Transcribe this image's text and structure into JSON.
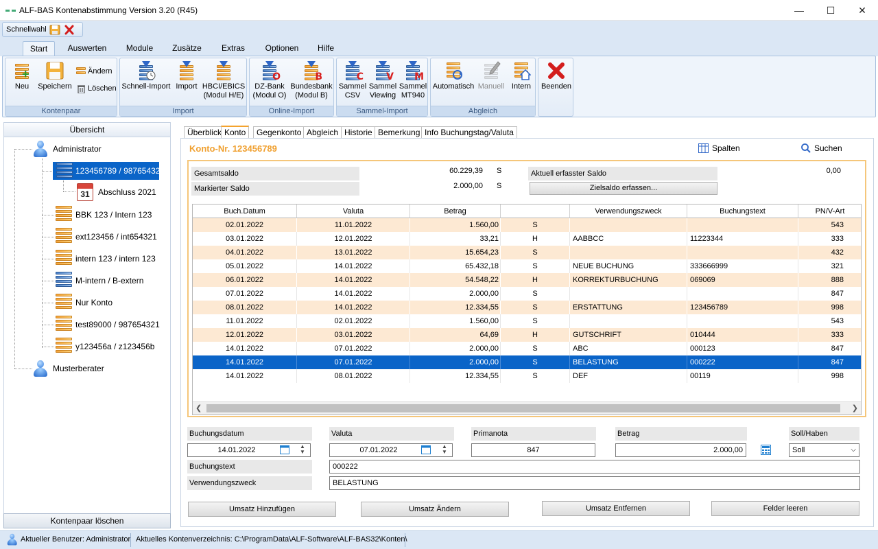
{
  "window": {
    "title": "ALF-BAS Kontenabstimmung Version 3.20 (R45)",
    "minimize": "—",
    "maximize": "☐",
    "close": "✕"
  },
  "quick_access": {
    "label": "Schnellwahl"
  },
  "ribbon": {
    "tabs": [
      "Start",
      "Auswerten",
      "Module",
      "Zusätze",
      "Extras",
      "Optionen",
      "Hilfe"
    ],
    "active_tab": "Start",
    "groups": {
      "kontenpaar": {
        "label": "Kontenpaar",
        "neu": "Neu",
        "speichern": "Speichern",
        "aendern": "Ändern",
        "loeschen": "Löschen"
      },
      "import": {
        "label": "Import",
        "schnell": "Schnell-Import",
        "import": "Import",
        "hbci_1": "HBCI/EBICS",
        "hbci_2": "(Modul H/E)"
      },
      "online_import": {
        "label": "Online-Import",
        "dz_1": "DZ-Bank",
        "dz_2": "(Modul O)",
        "bb_1": "Bundesbank",
        "bb_2": "(Modul B)"
      },
      "sammel_import": {
        "label": "Sammel-Import",
        "csv_1": "Sammel",
        "csv_2": "CSV",
        "view_1": "Sammel",
        "view_2": "Viewing",
        "mt_1": "Sammel",
        "mt_2": "MT940"
      },
      "abgleich": {
        "label": "Abgleich",
        "auto": "Automatisch",
        "manuell": "Manuell",
        "intern": "Intern"
      },
      "beenden": {
        "label": "Beenden"
      }
    }
  },
  "left_panel": {
    "header": "Übersicht",
    "tree": {
      "administrator": "Administrator",
      "selected": "123456789 / 987654321",
      "abschluss": "Abschluss 2021",
      "cal_day": "31",
      "items": [
        "BBK 123 / Intern 123",
        "ext123456 / int654321",
        "intern 123 / intern 123",
        "M-intern / B-extern",
        "Nur Konto",
        "test89000 / 987654321",
        "y123456a / z123456b"
      ],
      "musterberater": "Musterberater"
    },
    "delete_button": "Kontenpaar löschen"
  },
  "content_tabs": [
    "Überblick",
    "Konto",
    "Gegenkonto",
    "Abgleich",
    "Historie",
    "Bemerkung",
    "Info Buchungstag/Valuta"
  ],
  "active_content_tab": "Konto",
  "konto_title": "Konto-Nr. 123456789",
  "spalten": "Spalten",
  "suchen": "Suchen",
  "summary": {
    "gesamtsaldo_label": "Gesamtsaldo",
    "gesamtsaldo_value": "60.229,39",
    "gesamtsaldo_sh": "S",
    "markiert_label": "Markierter Saldo",
    "markiert_value": "2.000,00",
    "markiert_sh": "S",
    "aktuell_label": "Aktuell erfasster Saldo",
    "aktuell_value": "0,00",
    "zielsaldo_button": "Zielsaldo erfassen..."
  },
  "table": {
    "headers": [
      "Buch.Datum",
      "Valuta",
      "Betrag",
      "",
      "Verwendungszweck",
      "Buchungstext",
      "PN/V-Art"
    ],
    "rows": [
      [
        "02.01.2022",
        "11.01.2022",
        "1.560,00",
        "S",
        "",
        "",
        "543"
      ],
      [
        "03.01.2022",
        "12.01.2022",
        "33,21",
        "H",
        "AABBCC",
        "11223344",
        "333"
      ],
      [
        "04.01.2022",
        "13.01.2022",
        "15.654,23",
        "S",
        "",
        "",
        "432"
      ],
      [
        "05.01.2022",
        "14.01.2022",
        "65.432,18",
        "S",
        "NEUE BUCHUNG",
        "333666999",
        "321"
      ],
      [
        "06.01.2022",
        "14.01.2022",
        "54.548,22",
        "H",
        "KORREKTURBUCHUNG",
        "069069",
        "888"
      ],
      [
        "07.01.2022",
        "14.01.2022",
        "2.000,00",
        "S",
        "",
        "",
        "847"
      ],
      [
        "08.01.2022",
        "14.01.2022",
        "12.334,55",
        "S",
        "ERSTATTUNG",
        "123456789",
        "998"
      ],
      [
        "11.01.2022",
        "02.01.2022",
        "1.560,00",
        "S",
        "",
        "",
        "543"
      ],
      [
        "12.01.2022",
        "03.01.2022",
        "64,69",
        "H",
        "GUTSCHRIFT",
        "010444",
        "333"
      ],
      [
        "14.01.2022",
        "07.01.2022",
        "2.000,00",
        "S",
        "ABC",
        "000123",
        "847"
      ],
      [
        "14.01.2022",
        "07.01.2022",
        "2.000,00",
        "S",
        "BELASTUNG",
        "000222",
        "847"
      ],
      [
        "14.01.2022",
        "08.01.2022",
        "12.334,55",
        "S",
        "DEF",
        "00119",
        "998"
      ]
    ],
    "selected_row": 10
  },
  "form": {
    "buchungsdatum_label": "Buchungsdatum",
    "buchungsdatum": "14.01.2022",
    "valuta_label": "Valuta",
    "valuta": "07.01.2022",
    "primanota_label": "Primanota",
    "primanota": "847",
    "betrag_label": "Betrag",
    "betrag": "2.000,00",
    "sollhaben_label": "Soll/Haben",
    "sollhaben": "Soll",
    "buchungstext_label": "Buchungstext",
    "buchungstext": "000222",
    "verwendungszweck_label": "Verwendungszweck",
    "verwendungszweck": "BELASTUNG"
  },
  "buttons": {
    "hinzufuegen": "Umsatz Hinzufügen",
    "aendern": "Umsatz Ändern",
    "entfernen": "Umsatz Entfernen",
    "leeren": "Felder leeren"
  },
  "status": {
    "user": "Aktueller Benutzer: Administrator",
    "dir": "Aktuelles Kontenverzeichnis: C:\\ProgramData\\ALF-Software\\ALF-BAS32\\Konten\\"
  },
  "colors": {
    "accent": "#0a64c8",
    "orange": "#f0a030",
    "even_row": "#fde9d3",
    "ribbon_bg": "#dbe7f5"
  }
}
